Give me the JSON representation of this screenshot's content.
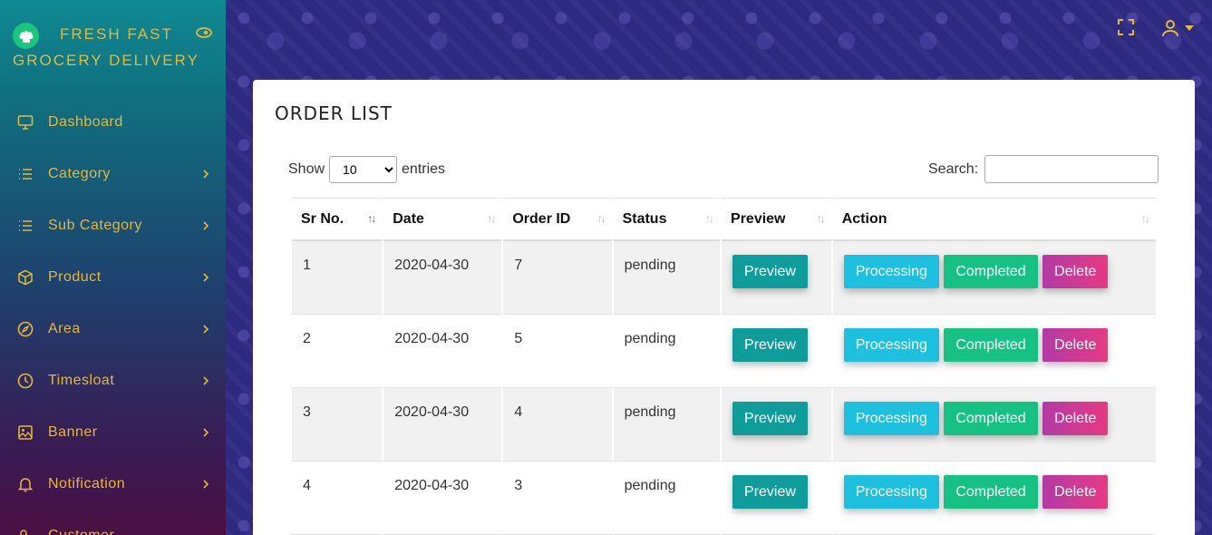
{
  "brand": {
    "line1": "FRESH FAST",
    "line2": "GROCERY DELIVERY",
    "logo_icon": "chef-hat-icon",
    "toggle_icon": "eye-toggle-icon"
  },
  "sidebar": {
    "items": [
      {
        "label": "Dashboard",
        "icon": "monitor-icon",
        "has_submenu": false
      },
      {
        "label": "Category",
        "icon": "list-icon",
        "has_submenu": true
      },
      {
        "label": "Sub Category",
        "icon": "list-icon",
        "has_submenu": true
      },
      {
        "label": "Product",
        "icon": "box-icon",
        "has_submenu": true
      },
      {
        "label": "Area",
        "icon": "compass-icon",
        "has_submenu": true
      },
      {
        "label": "Timesloat",
        "icon": "clock-icon",
        "has_submenu": true
      },
      {
        "label": "Banner",
        "icon": "image-icon",
        "has_submenu": true
      },
      {
        "label": "Notification",
        "icon": "bell-icon",
        "has_submenu": true
      },
      {
        "label": "Customer",
        "icon": "users-icon",
        "has_submenu": false
      }
    ]
  },
  "header": {
    "fullscreen_icon": "fullscreen-icon",
    "user_icon": "user-icon"
  },
  "page": {
    "title": "ORDER LIST"
  },
  "table_controls": {
    "show_label": "Show",
    "entries_label": "entries",
    "page_length": "10",
    "search_label": "Search:",
    "search_value": ""
  },
  "table": {
    "columns": [
      "Sr No.",
      "Date",
      "Order ID",
      "Status",
      "Preview",
      "Action"
    ],
    "rows": [
      {
        "sr": "1",
        "date": "2020-04-30",
        "order_id": "7",
        "status": "pending"
      },
      {
        "sr": "2",
        "date": "2020-04-30",
        "order_id": "5",
        "status": "pending"
      },
      {
        "sr": "3",
        "date": "2020-04-30",
        "order_id": "4",
        "status": "pending"
      },
      {
        "sr": "4",
        "date": "2020-04-30",
        "order_id": "3",
        "status": "pending"
      }
    ],
    "buttons": {
      "preview": "Preview",
      "processing": "Processing",
      "completed": "Completed",
      "delete": "Delete"
    }
  },
  "colors": {
    "accent": "#e3b93c",
    "preview": "#0f9d9c",
    "processing": "#1ec0e0",
    "completed": "#15c283",
    "delete": "#e63a83"
  }
}
